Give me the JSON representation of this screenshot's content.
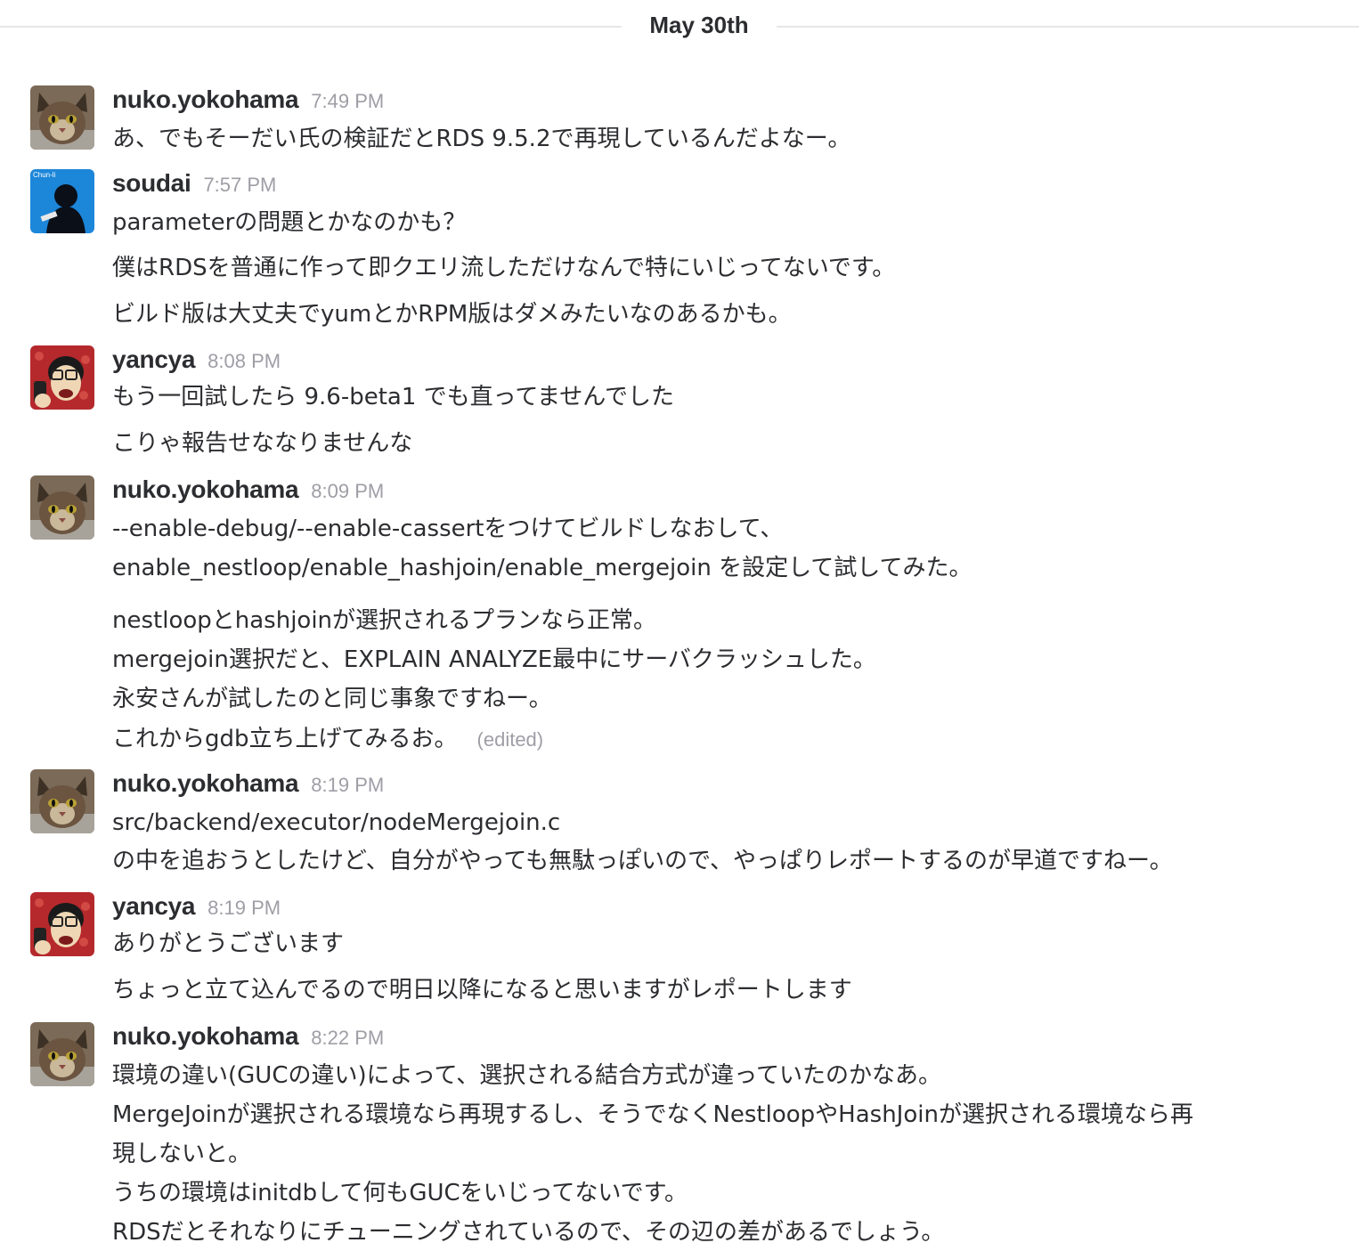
{
  "day_divider": "May 30th",
  "messages": [
    {
      "author": "nuko.yokohama",
      "time": "7:49 PM",
      "lines": [
        "あ、でもそーだい氏の検証だとRDS 9.5.2で再現しているんだよなー。"
      ]
    },
    {
      "author": "soudai",
      "time": "7:57 PM",
      "avatar_label": "Chun-li",
      "lines": [
        "parameterの問題とかなのかも？",
        "僕はRDSを普通に作って即クエリ流しただけなんで特にいじってないです。",
        "ビルド版は大丈夫でyumとかRPM版はダメみたいなのあるかも。"
      ]
    },
    {
      "author": "yancya",
      "time": "8:08 PM",
      "lines": [
        "もう一回試したら 9.6-beta1 でも直ってませんでした",
        "こりゃ報告せななりませんな"
      ]
    },
    {
      "author": "nuko.yokohama",
      "time": "8:09 PM",
      "lines": [
        "--enable-debug/--enable-cassertをつけてビルドしなおして、",
        "enable_nestloop/enable_hashjoin/enable_mergejoin を設定して試してみた。",
        "nestloopとhashjoinが選択されるプランなら正常。",
        "mergejoin選択だと、EXPLAIN ANALYZE最中にサーバクラッシュした。",
        "永安さんが試したのと同じ事象ですねー。",
        "これからgdb立ち上げてみるお。"
      ],
      "edited_label": "(edited)"
    },
    {
      "author": "nuko.yokohama",
      "time": "8:19 PM",
      "lines": [
        "src/backend/executor/nodeMergejoin.c",
        "の中を追おうとしたけど、自分がやっても無駄っぽいので、やっぱりレポートするのが早道ですねー。"
      ]
    },
    {
      "author": "yancya",
      "time": "8:19 PM",
      "lines": [
        "ありがとうございます",
        "ちょっと立て込んでるので明日以降になると思いますがレポートします"
      ]
    },
    {
      "author": "nuko.yokohama",
      "time": "8:22 PM",
      "lines": [
        "環境の違い(GUCの違い)によって、選択される結合方式が違っていたのかなあ。",
        "MergeJoinが選択される環境なら再現するし、そうでなくNestloopやHashJoinが選択される環境なら再",
        "現しないと。",
        "うちの環境はinitdbして何もGUCをいじってないです。",
        "RDSだとそれなりにチューニングされているので、その辺の差があるでしょう。"
      ]
    }
  ]
}
